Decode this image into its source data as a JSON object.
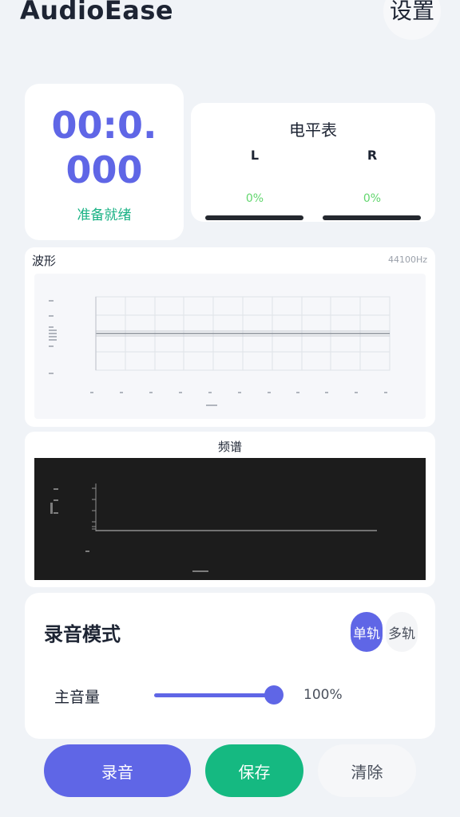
{
  "app": {
    "title": "AudioEase",
    "settings_label": "设置"
  },
  "timer": {
    "value": "00:0.000",
    "status": "准备就绪"
  },
  "level_meter": {
    "title": "电平表",
    "channels": [
      {
        "label": "L",
        "percent_text": "0%",
        "level": 0
      },
      {
        "label": "R",
        "percent_text": "0%",
        "level": 0
      }
    ]
  },
  "waveform": {
    "title": "波形",
    "sample_rate": "44100Hz"
  },
  "spectrum": {
    "title": "频谱"
  },
  "recording_mode": {
    "title": "录音模式",
    "options": [
      "单轨",
      "多轨"
    ],
    "selected": "单轨",
    "volume_label": "主音量",
    "volume_value": "100%",
    "volume_level": 1.0
  },
  "actions": {
    "record": "录音",
    "save": "保存",
    "clear": "清除"
  },
  "colors": {
    "accent": "#5f66e6",
    "success": "#15b981",
    "meter_text": "#62d66e",
    "background": "#f0f3f7"
  }
}
